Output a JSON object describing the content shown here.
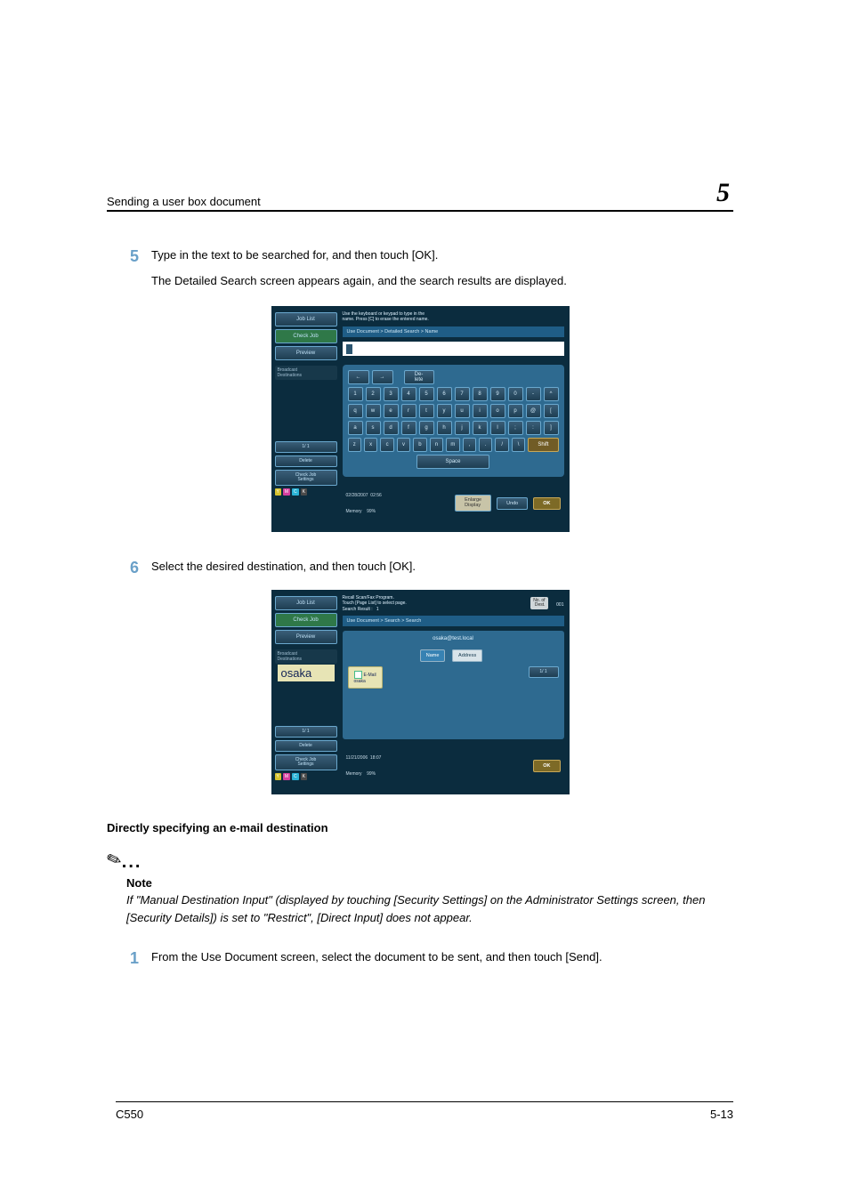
{
  "header": {
    "title": "Sending a user box document",
    "chapter": "5"
  },
  "step5": {
    "num": "5",
    "text": "Type in the text to be searched for, and then touch [OK].",
    "sub": "The Detailed Search screen appears again, and the search results are displayed."
  },
  "shot1": {
    "side": {
      "job_list": "Job List",
      "check_job": "Check Job",
      "preview": "Preview",
      "broadcast": "Broadcast\nDestinations",
      "page": "1/ 1",
      "delete": "Delete",
      "check_job_set": "Check Job\nSettings"
    },
    "hint": "Use the keyboard or keypad to type in the\nname. Press [C] to erase the entered name.",
    "breadcrumb": "Use Document > Detailed Search > Name",
    "keys": {
      "arrL": "←",
      "arrR": "→",
      "del": "De-\nlete",
      "r1": [
        "1",
        "2",
        "3",
        "4",
        "5",
        "6",
        "7",
        "8",
        "9",
        "0",
        "-",
        "^"
      ],
      "r2": [
        "q",
        "w",
        "e",
        "r",
        "t",
        "y",
        "u",
        "i",
        "o",
        "p",
        "@",
        "["
      ],
      "r3": [
        "a",
        "s",
        "d",
        "f",
        "g",
        "h",
        "j",
        "k",
        "l",
        ";",
        ":",
        "]"
      ],
      "r4": [
        "z",
        "x",
        "c",
        "v",
        "b",
        "n",
        "m",
        ",",
        ".",
        "/",
        "\\"
      ],
      "shift": "Shift",
      "space": "Space"
    },
    "footer": {
      "ts": "02/28/2007  02:56",
      "mem": "Memory    99%",
      "enlarge": "Enlarge\nDisplay",
      "undo": "Undo",
      "ok": "OK"
    },
    "toner": {
      "y": "Y",
      "m": "M",
      "c": "C",
      "k": "K"
    }
  },
  "step6": {
    "num": "6",
    "text": "Select the desired destination, and then touch [OK]."
  },
  "shot2": {
    "side": {
      "job_list": "Job List",
      "check_job": "Check Job",
      "preview": "Preview",
      "broadcast": "Broadcast\nDestinations",
      "dest": "osaka",
      "page": "1/ 1",
      "delete": "Delete",
      "check_job_set": "Check Job\nSettings"
    },
    "hint": "Recall Scan/Fax Program.\nTouch [Page List] to select page.\nSearch Result :   1",
    "count_lbl": "No. of\nDest.",
    "count_val": "001",
    "breadcrumb": "Use Document > Search > Search",
    "email": "osaka@test.local",
    "tabs": {
      "name": "Name",
      "address": "Address"
    },
    "result": {
      "type": "E-Mail",
      "name": "osaka"
    },
    "respage": "1/ 1",
    "footer": {
      "ts": "11/21/2006  18:07",
      "mem": "Memory    99%",
      "ok": "OK"
    }
  },
  "direct": {
    "title": "Directly specifying an e-mail destination",
    "note_label": "Note",
    "note_body": "If \"Manual Destination Input\" (displayed by touching [Security Settings] on the Administrator Settings screen, then [Security Details]) is set to \"Restrict\", [Direct Input] does not appear."
  },
  "step1": {
    "num": "1",
    "text": "From the Use Document screen, select the document to be sent, and then touch [Send]."
  },
  "pagefoot": {
    "model": "C550",
    "pg": "5-13"
  }
}
